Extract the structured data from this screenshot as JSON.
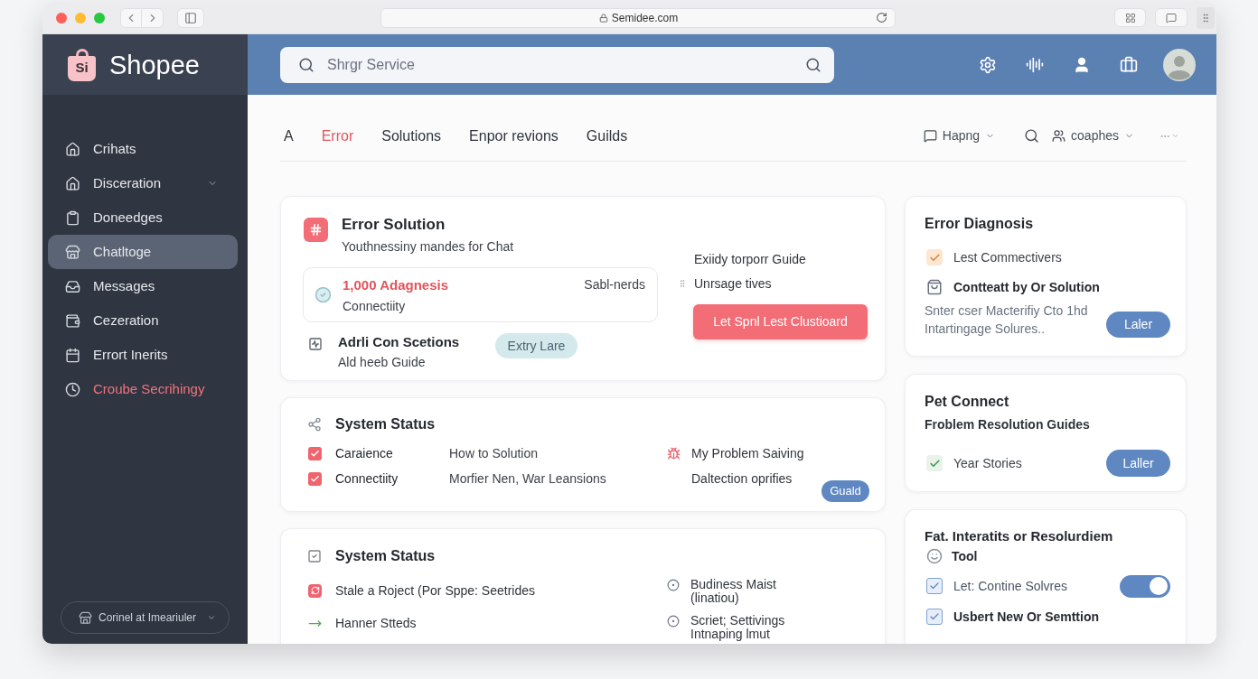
{
  "browser": {
    "url": "Semidee.com"
  },
  "sidebar": {
    "logo_badge": "Si",
    "logo": "Shopee",
    "items": [
      {
        "label": "Crihats",
        "selected": false,
        "alert": false,
        "has_submenu": false
      },
      {
        "label": "Disceration",
        "selected": false,
        "alert": false,
        "has_submenu": true
      },
      {
        "label": "Doneedges",
        "selected": false,
        "alert": false,
        "has_submenu": false
      },
      {
        "label": "Chatltoge",
        "selected": true,
        "alert": false,
        "has_submenu": false
      },
      {
        "label": "Messages",
        "selected": false,
        "alert": false,
        "has_submenu": false
      },
      {
        "label": "Cezeration",
        "selected": false,
        "alert": false,
        "has_submenu": false
      },
      {
        "label": "Errort Inerits",
        "selected": false,
        "alert": false,
        "has_submenu": false
      },
      {
        "label": "Croube Secrihingy",
        "selected": false,
        "alert": true,
        "has_submenu": false
      }
    ],
    "footer_button": "Corinel at Imeariuler"
  },
  "header": {
    "search": {
      "placeholder": "Shrgr Service"
    }
  },
  "tabs": [
    {
      "label": "A",
      "selected": false
    },
    {
      "label": "Error",
      "selected": true
    },
    {
      "label": "Solutions",
      "selected": false
    },
    {
      "label": "Enpor revions",
      "selected": false
    },
    {
      "label": "Guilds",
      "selected": false
    }
  ],
  "toolbar": {
    "filter_1": "Hapng",
    "filter_2": "coaphes"
  },
  "error_solution": {
    "title": "Error Solution",
    "subtitle": "Youthnessiny mandes for Chat",
    "highlight": {
      "title": "1,000 Adagnesis",
      "meta": "Sabl-nerds",
      "subtitle": "Connectiity"
    },
    "section": {
      "title": "Adrli Con Scetions",
      "subtitle": "Ald heeb Guide",
      "button": "Extry Lare"
    },
    "side_lines": [
      "Exiidy torporr Guide",
      "Unrsage tives"
    ],
    "button": "Let Spnl Lest Clustioard"
  },
  "system_status": {
    "title": "System Status",
    "rows": [
      {
        "checked": true,
        "label": "Caraience",
        "detail": "How to Solution"
      },
      {
        "checked": true,
        "label": "Connectiity",
        "detail": "Morfier Nen, War Leansions"
      }
    ],
    "side": {
      "title": "My Problem Saiving",
      "subtitle": "Daltection oprifies"
    },
    "button": "Guald"
  },
  "system_status_2": {
    "title": "System Status",
    "rows": [
      "Stale a Roject (Por Sppe: Seetrides",
      "Hanner Stteds"
    ],
    "side": [
      "Budiness Maist (linatiou)",
      "Scriet; Settivings Intnaping lmut"
    ]
  },
  "error_diagnosis": {
    "title": "Error Diagnosis",
    "check": {
      "label": "Lest Commectivers",
      "checked": true
    },
    "subheading": "Contteatt by Or Solution",
    "description": "Snter cser Macterifiy Cto 1hd Intartingage Solures..",
    "button": "Laler"
  },
  "pet_connect": {
    "title": "Pet Connect",
    "subtitle": "Froblem Resolution Guides",
    "check": {
      "label": "Year Stories",
      "checked": true
    },
    "button": "Laller"
  },
  "resolution": {
    "title": "Fat. Interatits or Resolurdiem",
    "items": [
      {
        "kind": "heading",
        "label": "Tool"
      },
      {
        "kind": "toggle",
        "label": "Let: Contine Solvres",
        "on": true
      },
      {
        "kind": "bold",
        "label": "Usbert New Or Semttion"
      }
    ]
  }
}
